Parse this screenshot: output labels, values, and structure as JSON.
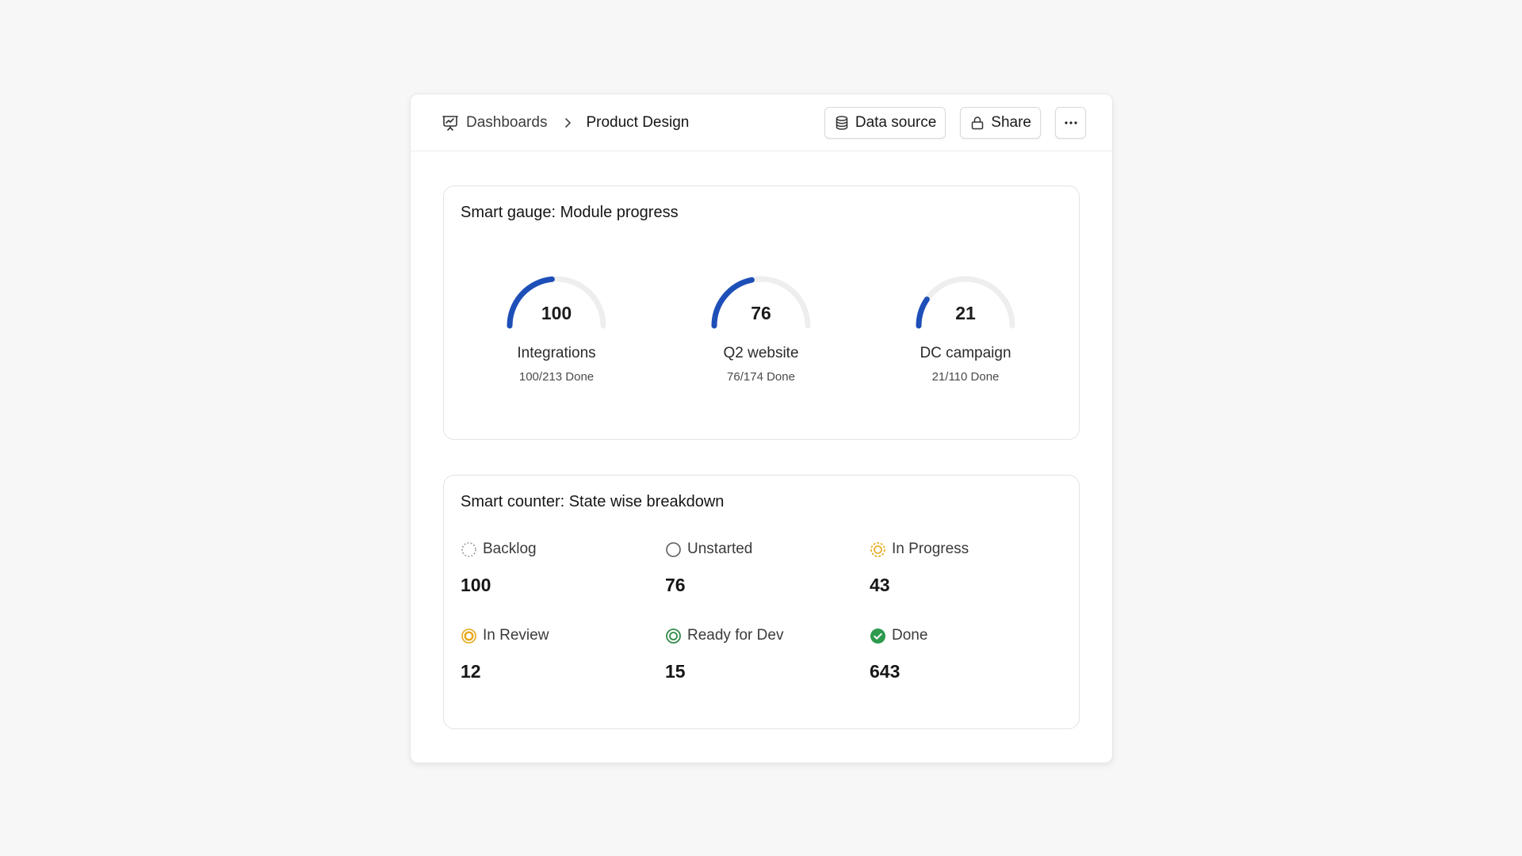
{
  "header": {
    "breadcrumb_root": "Dashboards",
    "breadcrumb_current": "Product Design",
    "data_source_label": "Data source",
    "share_label": "Share",
    "more_icon": "ellipsis-icon"
  },
  "gauge_card": {
    "title": "Smart gauge: Module progress",
    "accent_color": "#1e4fb8",
    "track_color": "#eeeeee",
    "gauges": [
      {
        "value": "100",
        "name": "Integrations",
        "sub": "100/213 Done",
        "done": 100,
        "total": 213
      },
      {
        "value": "76",
        "name": "Q2 website",
        "sub": "76/174 Done",
        "done": 76,
        "total": 174
      },
      {
        "value": "21",
        "name": "DC campaign",
        "sub": "21/110 Done",
        "done": 21,
        "total": 110
      }
    ]
  },
  "counter_card": {
    "title": "Smart counter: State wise breakdown",
    "states": [
      {
        "label": "Backlog",
        "value": "100",
        "icon": "backlog-dashed-circle-icon",
        "color": "#9a9a9a"
      },
      {
        "label": "Unstarted",
        "value": "76",
        "icon": "unstarted-circle-icon",
        "color": "#5c5c5c"
      },
      {
        "label": "In Progress",
        "value": "43",
        "icon": "in-progress-icon",
        "color": "#e6a817"
      },
      {
        "label": "In Review",
        "value": "12",
        "icon": "in-review-icon",
        "color": "#e6a817"
      },
      {
        "label": "Ready for Dev",
        "value": "15",
        "icon": "ready-for-dev-icon",
        "color": "#2e8b4a"
      },
      {
        "label": "Done",
        "value": "643",
        "icon": "done-check-icon",
        "color": "#2e9a4e"
      }
    ]
  }
}
